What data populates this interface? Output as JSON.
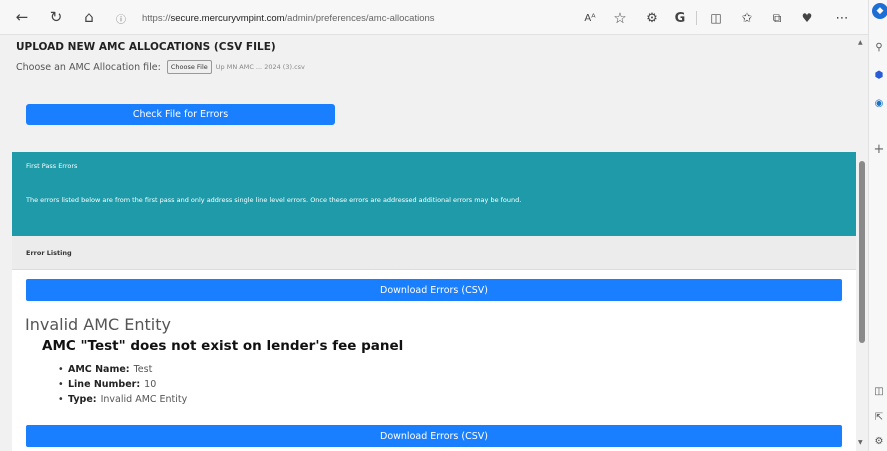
{
  "browser": {
    "url_prefix": "https://",
    "url_host": "secure.mercuryvmpint.com",
    "url_path": "/admin/preferences/amc-allocations"
  },
  "upload": {
    "title": "UPLOAD NEW AMC ALLOCATIONS (CSV FILE)",
    "choose_label": "Choose an AMC Allocation file:",
    "choose_button": "Choose File",
    "file_name": "Up MN AMC ... 2024 (3).csv",
    "check_button": "Check File for Errors"
  },
  "first_pass": {
    "title": "First Pass Errors",
    "message": "The errors listed below are from the first pass and only address single line level errors. Once these errors are addressed additional errors may be found."
  },
  "listing": {
    "title": "Error Listing",
    "download_button": "Download Errors (CSV)"
  },
  "error": {
    "type": "Invalid AMC Entity",
    "title": "AMC \"Test\" does not exist on lender's fee panel",
    "details": [
      {
        "label": "AMC Name:",
        "value": "Test"
      },
      {
        "label": "Line Number:",
        "value": "10"
      },
      {
        "label": "Type:",
        "value": "Invalid AMC Entity"
      }
    ]
  },
  "colors": {
    "accent_blue": "#1a7fff",
    "teal_header": "#1e9aa8"
  }
}
